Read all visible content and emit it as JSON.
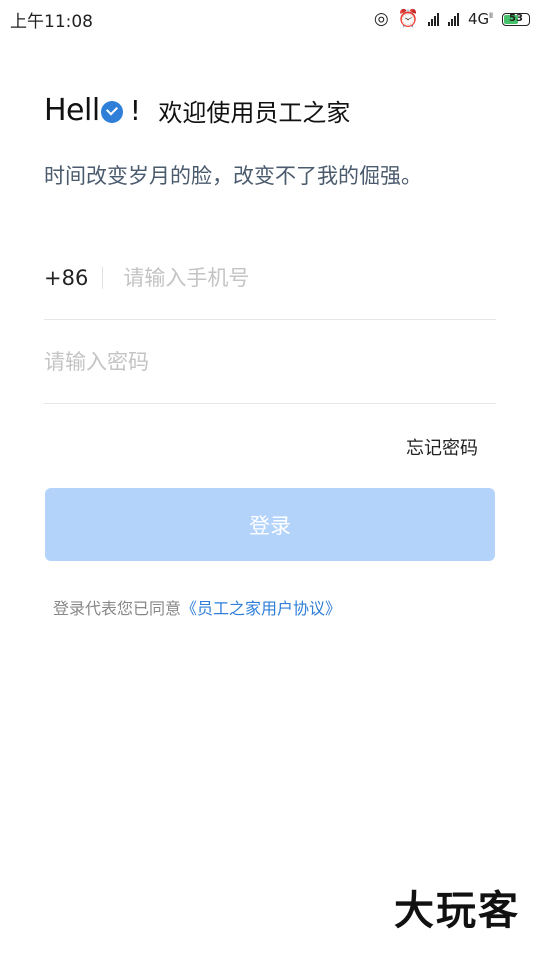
{
  "status_bar": {
    "time": "上午11:08",
    "network": "4G",
    "battery": "53"
  },
  "header": {
    "hello_prefix": "Hell",
    "hello_suffix": "!",
    "title": "欢迎使用员工之家",
    "subtitle": "时间改变岁月的脸，改变不了我的倔强。"
  },
  "form": {
    "country_code": "+86",
    "phone_placeholder": "请输入手机号",
    "phone_value": "",
    "password_placeholder": "请输入密码",
    "password_value": "",
    "forgot_label": "忘记密码",
    "login_label": "登录"
  },
  "agreement": {
    "prefix": "登录代表您已同意",
    "link": "《员工之家用户协议》"
  },
  "watermark": "大玩客",
  "colors": {
    "accent": "#2f7fd9",
    "button_disabled": "#b3d3fb"
  }
}
